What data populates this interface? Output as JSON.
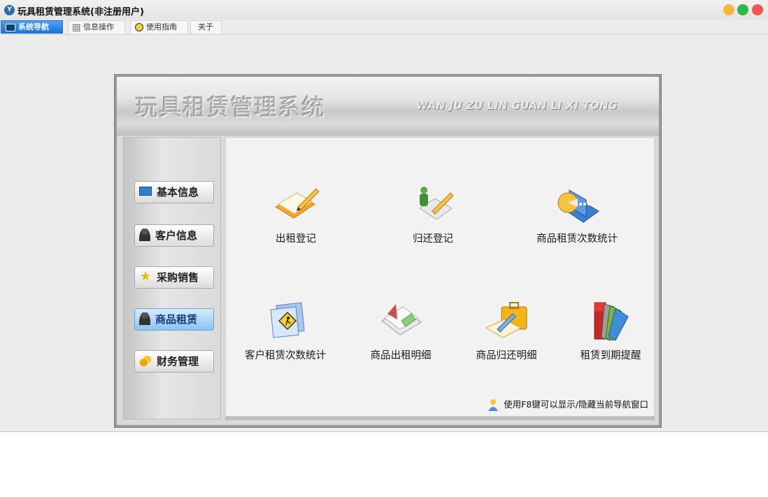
{
  "window": {
    "title": "玩具租赁管理系统(非注册用户)",
    "app_icon": "app-logo-icon"
  },
  "tabs": [
    {
      "label": "系统导航",
      "icon": "monitor-icon",
      "active": true
    },
    {
      "label": "信息操作",
      "icon": "grid-icon",
      "active": false
    },
    {
      "label": "使用指南",
      "icon": "clock-icon",
      "active": false
    },
    {
      "label": "关于",
      "icon": "",
      "active": false
    }
  ],
  "banner": {
    "title": "玩具租赁管理系统",
    "subtitle": "WAN JU ZU LIN GUAN LI XI TONG"
  },
  "sidebar": {
    "items": [
      {
        "label": "基本信息",
        "icon": "monitor-icon",
        "active": false
      },
      {
        "label": "客户信息",
        "icon": "person-icon",
        "active": false
      },
      {
        "label": "采购销售",
        "icon": "star-icon",
        "active": false
      },
      {
        "label": "商品租赁",
        "icon": "person-icon",
        "active": true
      },
      {
        "label": "财务管理",
        "icon": "coins-icon",
        "active": false
      }
    ]
  },
  "main": {
    "items": [
      {
        "label": "出租登记",
        "icon": "book-pen-icon"
      },
      {
        "label": "归还登记",
        "icon": "figure-pen-icon"
      },
      {
        "label": "商品租赁次数统计",
        "icon": "pie-book-icon"
      },
      {
        "label": "客户租赁次数统计",
        "icon": "folder-sign-icon"
      },
      {
        "label": "商品出租明细",
        "icon": "open-book-icon"
      },
      {
        "label": "商品归还明细",
        "icon": "briefcase-pen-icon"
      },
      {
        "label": "租赁到期提醒",
        "icon": "color-swatches-icon"
      }
    ],
    "hint": "使用F8键可以显示/隐藏当前导航窗口"
  },
  "colors": {
    "active_tab": "#1870d6",
    "active_nav": "#8cc3f0",
    "close": "#f0574f",
    "maximize": "#2fb84a",
    "minimize": "#f7b73a"
  }
}
